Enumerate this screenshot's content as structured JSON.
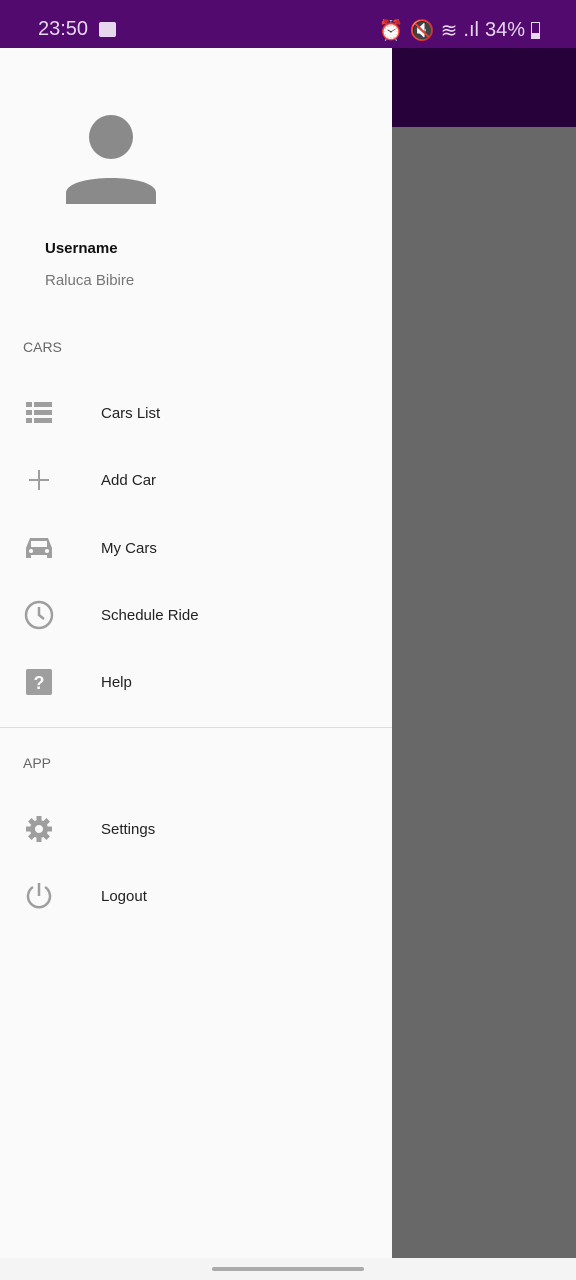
{
  "status_bar": {
    "time": "23:50",
    "battery": "34%"
  },
  "header": {
    "username_label": "Username",
    "username_value": "Raluca Bibire"
  },
  "sections": [
    {
      "title": "CARS",
      "items": [
        {
          "label": "Cars List",
          "icon": "list-icon"
        },
        {
          "label": "Add Car",
          "icon": "plus-icon"
        },
        {
          "label": "My Cars",
          "icon": "car-icon"
        },
        {
          "label": "Schedule Ride",
          "icon": "clock-icon"
        },
        {
          "label": "Help",
          "icon": "help-icon"
        }
      ]
    },
    {
      "title": "APP",
      "items": [
        {
          "label": "Settings",
          "icon": "gear-icon"
        },
        {
          "label": "Logout",
          "icon": "power-icon"
        }
      ]
    }
  ],
  "colors": {
    "status_bar": "#530a6e",
    "app_bar": "#27023a",
    "scrim": "#686868",
    "icon": "#9e9e9e"
  }
}
